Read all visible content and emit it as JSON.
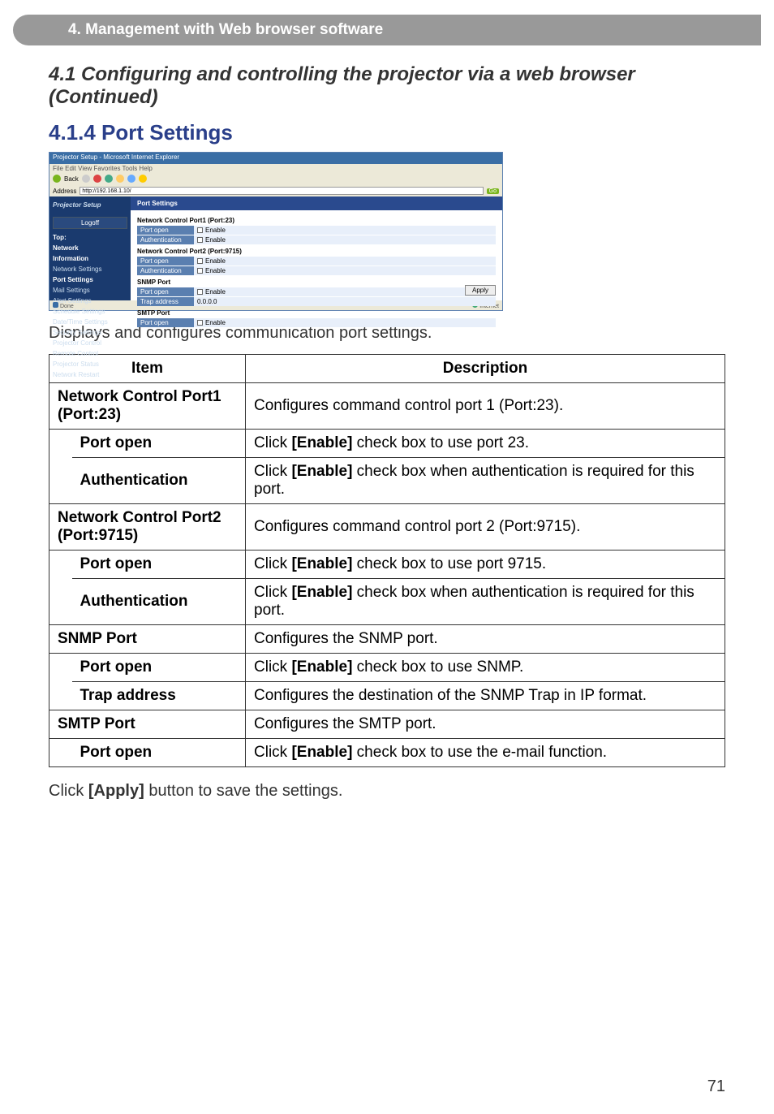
{
  "header": {
    "chapter": "4. Management with Web browser software"
  },
  "section": {
    "title": "4.1 Configuring and controlling the projector via a web browser (Continued)",
    "subtitle": "4.1.4 Port Settings"
  },
  "screenshot": {
    "window_title": "Projector Setup - Microsoft Internet Explorer",
    "menu": "File   Edit   View   Favorites   Tools   Help",
    "back": "Back",
    "address_label": "Address",
    "address_value": "http://192.168.1.10/",
    "go": "Go",
    "sidebar": {
      "title": "Projector Setup",
      "logoff": "Logoff",
      "cat_top": "Top:",
      "cat_network": "Network",
      "cat_info": "Information",
      "items": [
        "Network Settings",
        "Port Settings",
        "Mail Settings",
        "Alert Settings",
        "Schedule Settings",
        "Date/Time Settings",
        "Security Settings",
        "Projector Control",
        "Remote Control",
        "Projector Status",
        "Network Restart"
      ]
    },
    "content": {
      "title": "Port Settings",
      "s1": "Network Control Port1 (Port:23)",
      "s2": "Network Control Port2 (Port:9715)",
      "s3": "SNMP Port",
      "s4": "SMTP Port",
      "port_open": "Port open",
      "authentication": "Authentication",
      "trap_address": "Trap address",
      "enable": "Enable",
      "trap_val": "0.0.0.0",
      "apply": "Apply"
    },
    "status": {
      "done": "Done",
      "internet": "Internet"
    }
  },
  "intro_text": "Displays and configures communication port settings.",
  "table": {
    "header_item": "Item",
    "header_desc": "Description",
    "ncp1": {
      "name": "Network Control Port1 (Port:23)",
      "desc": "Configures command control port 1 (Port:23)."
    },
    "ncp1_portopen": {
      "name": "Port open",
      "desc_pre": "Click ",
      "desc_bold": "[Enable]",
      "desc_post": " check box to use port 23."
    },
    "ncp1_auth": {
      "name": "Authentication",
      "desc_pre": "Click ",
      "desc_bold": "[Enable]",
      "desc_post": " check box when authentication is required for this port."
    },
    "ncp2": {
      "name": "Network Control Port2 (Port:9715)",
      "desc": "Configures command control port 2 (Port:9715)."
    },
    "ncp2_portopen": {
      "name": "Port open",
      "desc_pre": "Click ",
      "desc_bold": "[Enable]",
      "desc_post": " check box to use port 9715."
    },
    "ncp2_auth": {
      "name": "Authentication",
      "desc_pre": "Click ",
      "desc_bold": "[Enable]",
      "desc_post": " check box when authentication is required for this port."
    },
    "snmp": {
      "name": "SNMP Port",
      "desc": "Configures the SNMP port."
    },
    "snmp_portopen": {
      "name": "Port open",
      "desc_pre": "Click ",
      "desc_bold": "[Enable]",
      "desc_post": " check box to use SNMP."
    },
    "snmp_trap": {
      "name": "Trap address",
      "desc": "Configures the destination of the SNMP Trap in IP format."
    },
    "smtp": {
      "name": "SMTP Port",
      "desc": "Configures the SMTP port."
    },
    "smtp_portopen": {
      "name": "Port open",
      "desc_pre": "Click ",
      "desc_bold": "[Enable]",
      "desc_post": " check box to use the e-mail function."
    }
  },
  "footer_text_pre": "Click ",
  "footer_text_bold": "[Apply]",
  "footer_text_post": " button to save the settings.",
  "page_number": "71"
}
